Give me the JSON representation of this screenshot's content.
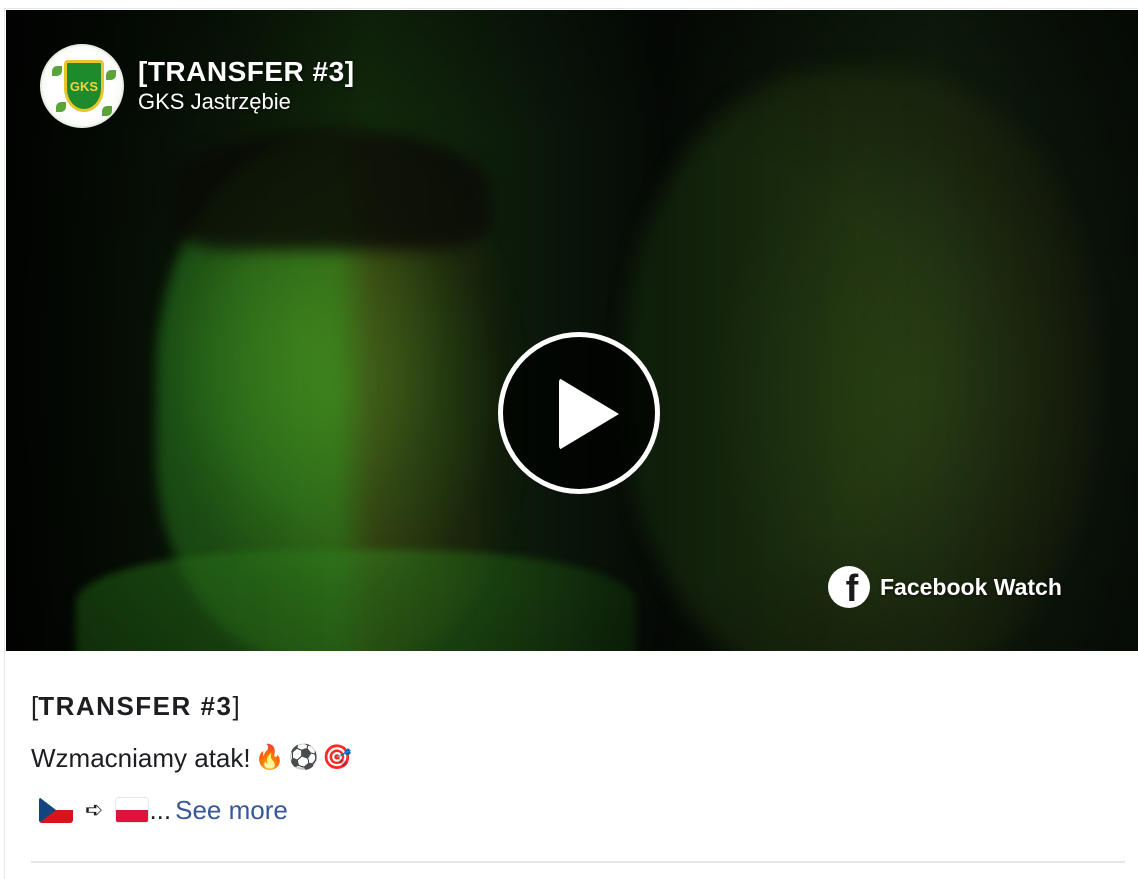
{
  "video": {
    "title": "[TRANSFER #3]",
    "page_name": "GKS Jastrzębie",
    "crest_text": "GKS",
    "watch_label": "Facebook Watch",
    "fb_letter": "f"
  },
  "caption": {
    "title_open": "[",
    "title_bold": "TRANSFER",
    "title_hash": " #",
    "title_num": "3",
    "title_close": "]",
    "body_text": "Wzmacniamy atak!",
    "emojis": [
      "🔥",
      "⚽",
      "🎯"
    ],
    "arrow": "➪",
    "ellipsis": "...",
    "see_more": "See more"
  },
  "colors": {
    "link": "#385898",
    "text": "#1c1e21",
    "divider": "#e4e6eb"
  }
}
